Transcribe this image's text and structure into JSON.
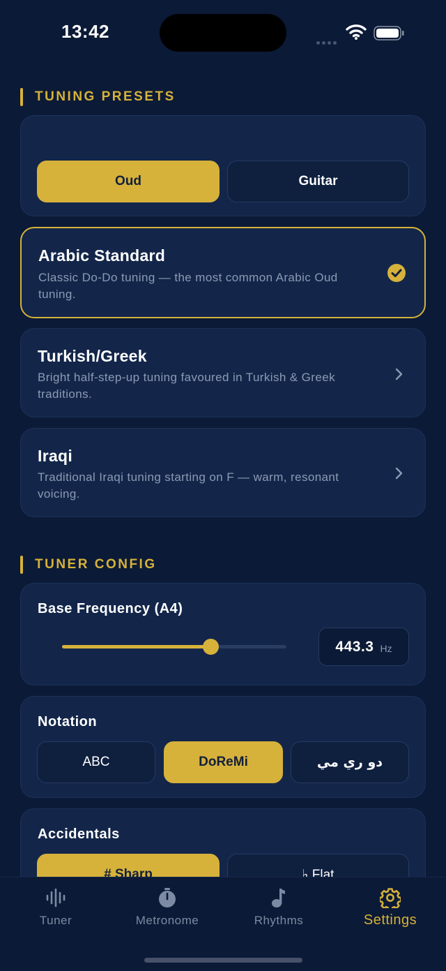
{
  "status_bar": {
    "time": "13:42"
  },
  "sections": {
    "tuning_presets": "TUNING PRESETS",
    "tuner_config": "TUNER CONFIG"
  },
  "instrument_toggle": {
    "options": [
      "Oud",
      "Guitar"
    ],
    "selected": "Oud"
  },
  "presets": [
    {
      "title": "Arabic Standard",
      "desc": "Classic Do-Do tuning — the most common Arabic Oud tuning.",
      "selected": true
    },
    {
      "title": "Turkish/Greek",
      "desc": "Bright half-step-up tuning favoured in Turkish & Greek traditions.",
      "selected": false
    },
    {
      "title": "Iraqi",
      "desc": "Traditional Iraqi tuning starting on F — warm, resonant voicing.",
      "selected": false
    }
  ],
  "base_frequency": {
    "label": "Base Frequency (A4)",
    "value": "443.3",
    "unit": "Hz",
    "slider_fraction": 0.66
  },
  "notation": {
    "label": "Notation",
    "options": [
      "ABC",
      "DoReMi",
      "دو ري مي"
    ],
    "selected": "DoReMi"
  },
  "accidentals": {
    "label": "Accidentals",
    "options": [
      "# Sharp",
      "♭ Flat"
    ],
    "selected": "# Sharp"
  },
  "tab_bar": {
    "tabs": [
      {
        "label": "Tuner",
        "icon": "waveform-icon"
      },
      {
        "label": "Metronome",
        "icon": "timer-icon"
      },
      {
        "label": "Rhythms",
        "icon": "music-note-icon"
      },
      {
        "label": "Settings",
        "icon": "gear-icon"
      }
    ],
    "active": "Settings"
  },
  "colors": {
    "accent": "#d6b23b",
    "background": "#0b1a36",
    "card": "#13264a",
    "muted": "#8c9ab3"
  }
}
